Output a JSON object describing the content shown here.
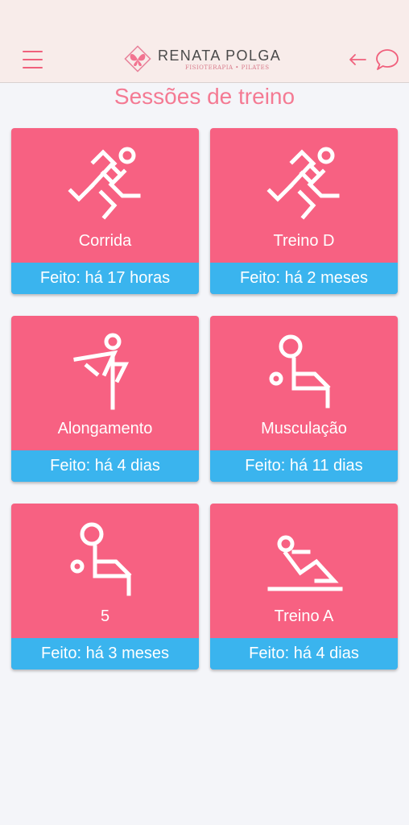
{
  "header": {
    "brand_name": "RENATA POLGA",
    "brand_tagline": "FISIOTERAPIA • PILATES",
    "colors": {
      "background": "#f8ecea",
      "accent": "#f0607c"
    },
    "icons": {
      "menu": "hamburger-menu-icon",
      "back": "arrow-left-icon",
      "chat": "chat-bubble-icon",
      "logo": "butterfly-logo-icon"
    }
  },
  "page": {
    "title": "Sessões de treino"
  },
  "sessions": [
    {
      "label": "Corrida",
      "status": "Feito: há 17 horas",
      "icon": "runner-icon"
    },
    {
      "label": "Treino D",
      "status": "Feito: há 2 meses",
      "icon": "runner-icon"
    },
    {
      "label": "Alongamento",
      "status": "Feito: há 4 dias",
      "icon": "stretching-icon"
    },
    {
      "label": "Musculação",
      "status": "Feito: há 11 dias",
      "icon": "weightlifting-icon"
    },
    {
      "label": "5",
      "status": "Feito: há 3 meses",
      "icon": "weightlifting-icon"
    },
    {
      "label": "Treino A",
      "status": "Feito: há 4 dias",
      "icon": "floor-exercise-icon"
    }
  ],
  "colors": {
    "card": "#f76182",
    "status_bar": "#3ab4ee",
    "title": "#f47a93"
  }
}
